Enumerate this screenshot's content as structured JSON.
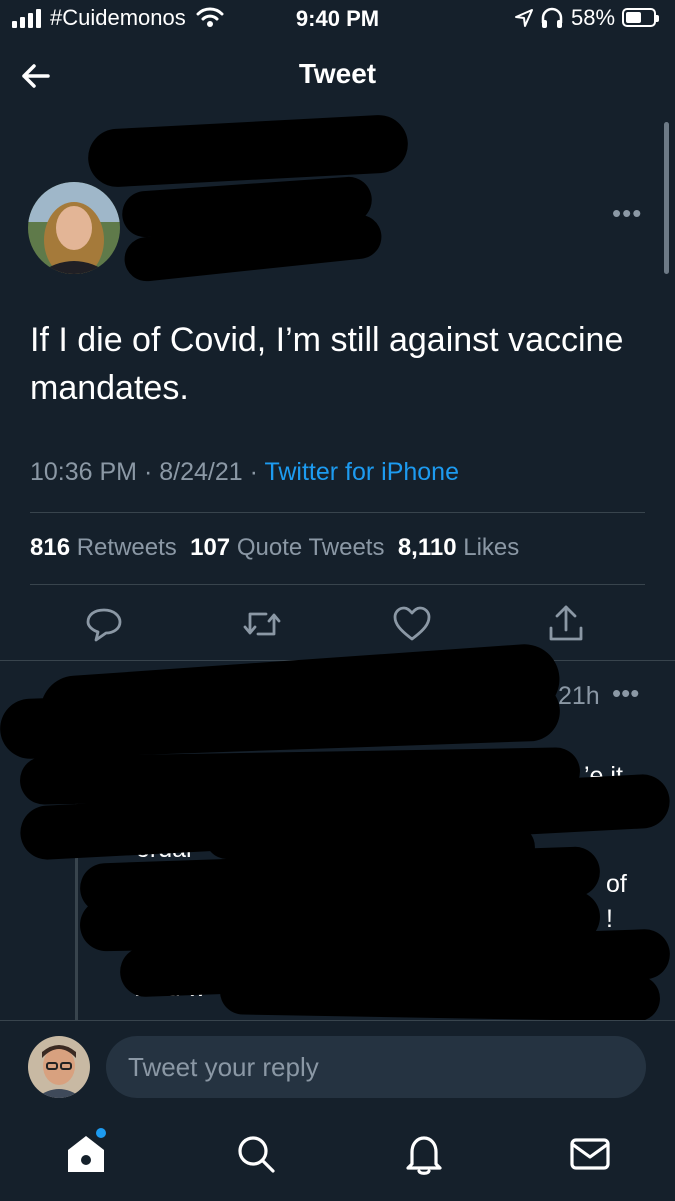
{
  "status_bar": {
    "carrier": "#Cuidemonos",
    "time": "9:40 PM",
    "battery": "58%",
    "battery_level": 0.58,
    "icons": [
      "signal-icon",
      "wifi-icon",
      "location-icon",
      "headphones-icon",
      "battery-icon"
    ]
  },
  "header": {
    "title": "Tweet",
    "back_icon": "arrow-left-icon"
  },
  "tweet": {
    "text": "If I die of Covid, I’m still against vaccine mandates.",
    "time": "10:36 PM",
    "date": "8/24/21",
    "separator": "·",
    "source": "Twitter for iPhone",
    "stats": {
      "retweets_count": "816",
      "retweets_label": "Retweets",
      "quotes_count": "107",
      "quotes_label": "Quote Tweets",
      "likes_count": "8,110",
      "likes_label": "Likes"
    },
    "more": "•••",
    "actions": [
      "reply-icon",
      "retweet-icon",
      "like-icon",
      "share-icon"
    ]
  },
  "reply": {
    "time": "21h",
    "more": "•••",
    "visible_fragments": [
      "’e it",
      "ordai",
      "of",
      "!",
      "And w"
    ]
  },
  "composer": {
    "placeholder": "Tweet your reply"
  },
  "bottom_nav": [
    "home-icon",
    "search-icon",
    "notifications-icon",
    "messages-icon"
  ],
  "colors": {
    "background": "#15202b",
    "accent": "#1d9bf0",
    "secondary_text": "#8b98a5",
    "divider": "#38444d"
  }
}
